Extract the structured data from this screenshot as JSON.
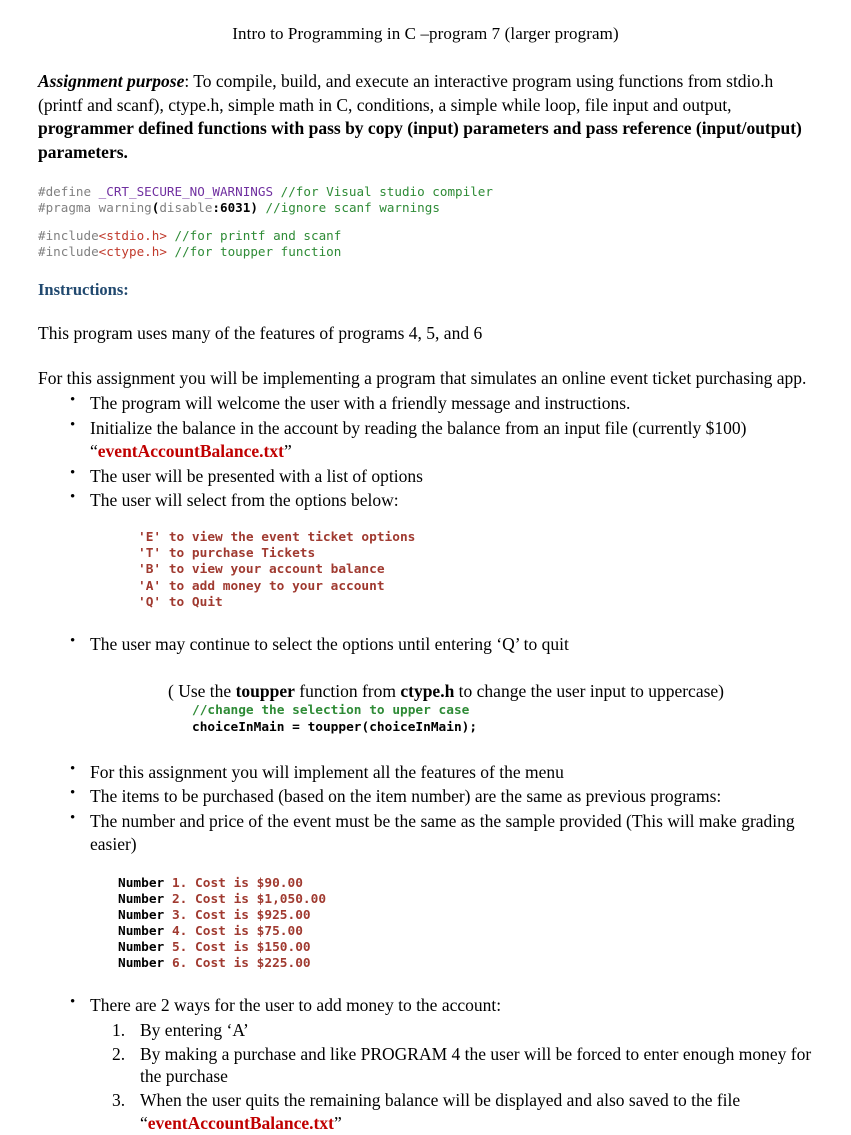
{
  "document": {
    "title": "Intro to Programming in C –program 7 (larger program)",
    "purpose": {
      "label": "Assignment purpose",
      "colon": ": ",
      "text_1": "To compile, build, and execute an interactive program using functions from stdio.h (printf and scanf), ctype.h, simple math in C, conditions, a simple while loop, file input and output, ",
      "bold_tail": "programmer defined functions with pass by copy (input) parameters and pass reference (input/output) parameters."
    },
    "code_header": {
      "line1_directive": "#define",
      "line1_macro": " _CRT_SECURE_NO_WARNINGS",
      "line1_comment": " //for Visual studio compiler",
      "line2_directive": "#pragma",
      "line2_kw": " warning",
      "line2_paren_open": "(",
      "line2_arg": "disable",
      "line2_colon": ":",
      "line2_num": "6031",
      "line2_paren_close": ")",
      "line2_comment": " //ignore scanf warnings",
      "line3_directive": "#include",
      "line3_header": "<stdio.h>",
      "line3_comment": " //for printf and scanf",
      "line4_directive": "#include",
      "line4_header": "<ctype.h>",
      "line4_comment": " //for toupper function"
    },
    "instructions_heading": "Instructions:",
    "intro_line": "This program uses many of the features of programs  4, 5, and 6",
    "assignment_line": "For this assignment you will be implementing a program that simulates an online event ticket purchasing app.",
    "bullets_group_1": [
      {
        "text": "The program will welcome the user with a friendly message and instructions."
      },
      {
        "text": "Initialize the balance in the account by reading the balance from an input file (currently $100)",
        "file_prefix": "“",
        "file": "eventAccountBalance.txt",
        "file_suffix": "”"
      },
      {
        "text": "The user will be presented with a list of options"
      },
      {
        "text": "The user will select from the options below:"
      }
    ],
    "menu_options": [
      "'E' to view the event ticket options",
      "'T' to purchase Tickets",
      "'B' to view your account balance",
      "'A' to add money to your account",
      "'Q' to Quit"
    ],
    "bullets_group_2": [
      {
        "text": "The user may continue to select the options until entering ‘Q’ to quit"
      }
    ],
    "toupper_note": {
      "pre": "( Use the ",
      "fn": "toupper",
      "mid": " function from ",
      "header": "ctype.h",
      "post": " to change the user input to uppercase)"
    },
    "toupper_code": {
      "comment": "//change the selection to upper case",
      "statement": "choiceInMain = toupper(choiceInMain);"
    },
    "bullets_group_3": [
      {
        "text": "For this assignment you will  implement all the features of the menu"
      },
      {
        "text": "The items to be purchased (based on the item number) are the same as previous programs:"
      },
      {
        "text": "The number and price of the event must be the same as the sample provided (This will make grading easier)"
      }
    ],
    "price_list": [
      {
        "label": "Number ",
        "rest": "1. Cost is $90.00"
      },
      {
        "label": "Number ",
        "rest": "2. Cost is $1,050.00"
      },
      {
        "label": "Number ",
        "rest": "3. Cost is $925.00"
      },
      {
        "label": "Number ",
        "rest": "4. Cost is $75.00"
      },
      {
        "label": "Number ",
        "rest": "5. Cost is $150.00"
      },
      {
        "label": "Number ",
        "rest": "6. Cost is $225.00"
      }
    ],
    "bullets_group_4": [
      {
        "text": "There are 2 ways for the user to add money to the account:"
      }
    ],
    "numbered_list": [
      {
        "text": "By entering ‘A’"
      },
      {
        "text": "By making a purchase and like PROGRAM 4 the user will be forced to enter enough money for the purchase"
      },
      {
        "text": "When the user quits the remaining balance will be displayed and also saved to the file",
        "file_prefix": "“",
        "file": "eventAccountBalance.txt",
        "file_suffix": "”"
      }
    ],
    "colors": {
      "heading_blue": "#21496F",
      "file_red": "#C00000",
      "code_comment_green": "#2E8B36",
      "code_macro_purple": "#7030A0",
      "code_header_red": "#C0392B",
      "code_directive_gray": "#808080",
      "menu_red": "#A03A30"
    }
  }
}
